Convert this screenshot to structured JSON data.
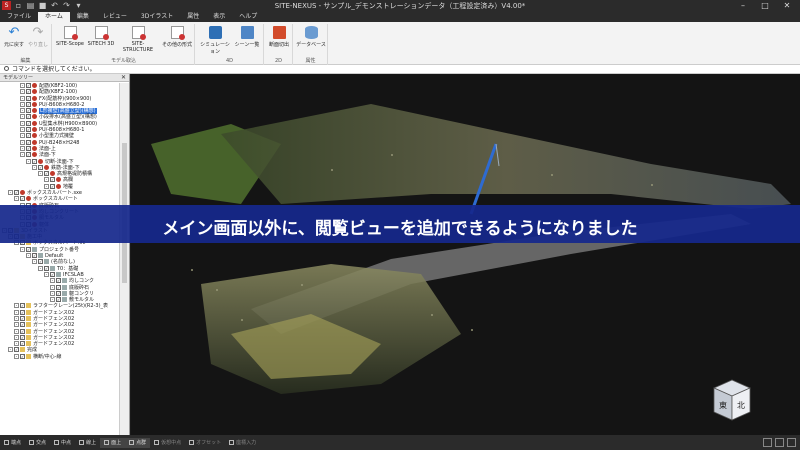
{
  "app": {
    "title": "SITE-NEXUS - サンプル_デモンストレーションデータ（工程設定済み）V4.00*"
  },
  "menu_tabs": [
    "ファイル",
    "ホーム",
    "編集",
    "レビュー",
    "3Dイラスト",
    "属性",
    "表示",
    "ヘルプ"
  ],
  "active_tab": "ホーム",
  "ribbon": {
    "groups": [
      {
        "label": "編集",
        "buttons": [
          "元に戻す",
          "やり直し"
        ]
      },
      {
        "label": "モデル取込",
        "buttons": [
          "SITE-Scope",
          "SiTECH 3D",
          "SITE-STRUCTURE",
          "その他の形式"
        ]
      },
      {
        "label": "4D",
        "buttons": [
          "シミュレーション",
          "シーン一覧"
        ]
      },
      {
        "label": "2D",
        "buttons": [
          "断面切出"
        ]
      },
      {
        "label": "属性",
        "buttons": [
          "データベース"
        ]
      }
    ]
  },
  "prompt": "コマンドを選択してください。",
  "tree": {
    "header": "モデルツリー",
    "items": [
      "配筋(KBF2-100)",
      "配筋(KBF2-100)",
      "FX(配筋枠)(900×900)",
      "PU/-B608×H680-2",
      "L形擁壁(高盛立型)(構想)",
      "小段排水(高盛立型)(構想)",
      "U型集水桝(H900×B900)",
      "PU/-B608×H680-1",
      "小型重力式擁壁",
      "PU/-B248×H248",
      "法面-上",
      "法面-下",
      "切断-法面-下",
      "鉄筋-法面-下",
      "高規格堤防積構",
      "高欄",
      "地覆",
      "ボックスカルバート.sxe",
      "ボックスカルバート",
      "底版砕石",
      "均しコンクリート",
      "胴モルタル",
      "躯体",
      "3Dイラスト",
      "施工中",
      "ボックスカルバート.ifc",
      "プロジェクト番号",
      "Default",
      "(名前なし)",
      "T0：基礎",
      "IFCSLAB",
      "均しコンク",
      "底版砕石",
      "躯コンクリ",
      "敷モルタル",
      "ラフタークレーン(25t)(R2-3)_表",
      "ガードフェンス02",
      "ガードフェンス02",
      "ガードフェンス02",
      "ガードフェンス02",
      "ガードフェンス02",
      "ガードフェンス02",
      "完成",
      "横断/中心-線"
    ]
  },
  "caption": "メイン画面以外に、閲覧ビューを追加できるようになりました",
  "viewcube": {
    "face_left": "東",
    "face_right": "北"
  },
  "statusbar": {
    "items": [
      "端点",
      "交点",
      "中点",
      "線上",
      "面上",
      "点群",
      "仮想中点",
      "オフセット",
      "座標入力"
    ],
    "active": [
      "面上",
      "点群"
    ]
  }
}
